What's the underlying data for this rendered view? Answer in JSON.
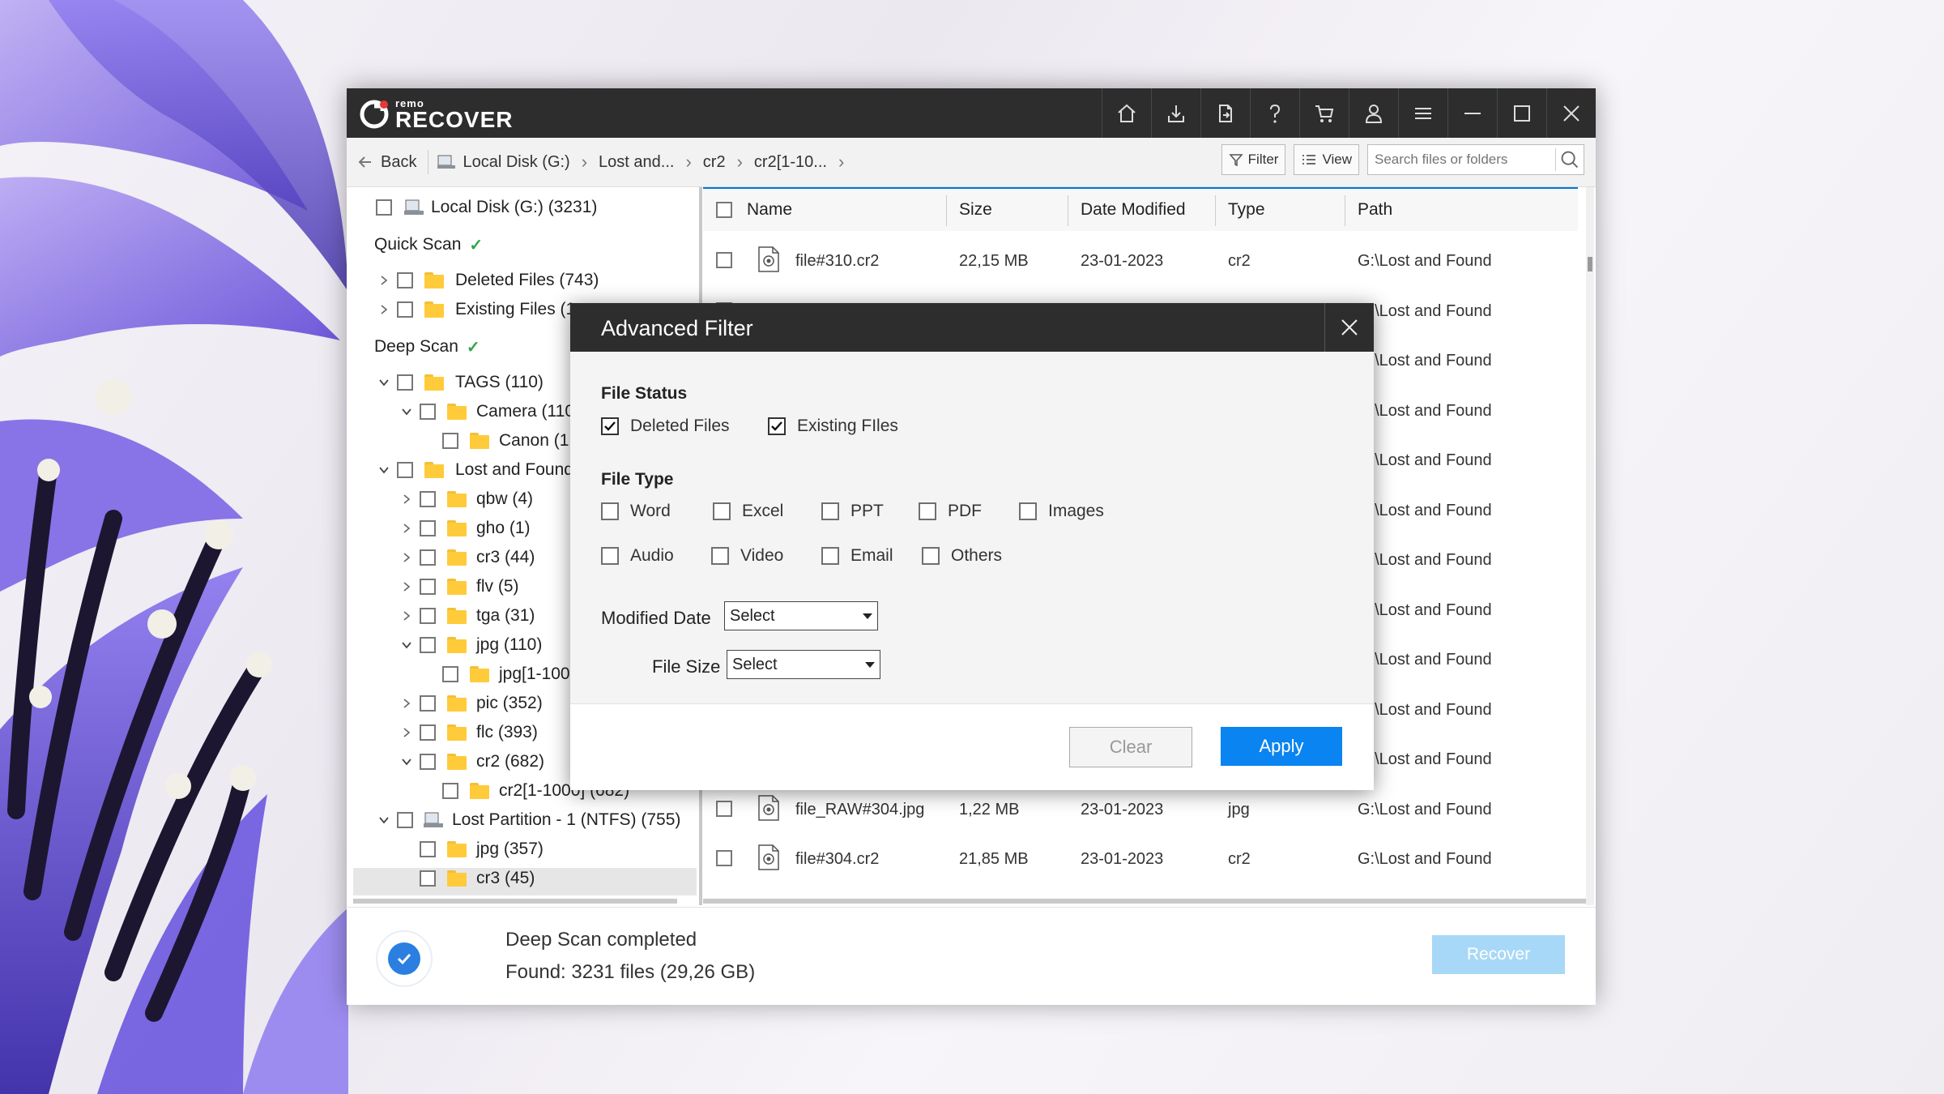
{
  "app": {
    "logo_small": "remo",
    "logo_big": "RECOVER",
    "toolbar_icons": [
      "home-icon",
      "save-icon",
      "export-icon",
      "help-icon",
      "cart-icon",
      "user-icon",
      "menu-icon",
      "minimize-icon",
      "maximize-icon",
      "close-icon"
    ]
  },
  "nav": {
    "back": "Back",
    "crumbs": [
      "Local Disk (G:)",
      "Lost and...",
      "cr2",
      "cr2[1-10..."
    ],
    "filter": "Filter",
    "view": "View",
    "search_placeholder": "Search files or folders"
  },
  "tree": {
    "root": "Local Disk (G:) (3231)",
    "quick_scan": "Quick Scan",
    "deep_scan": "Deep Scan",
    "items": [
      {
        "label": "Deleted Files (743)"
      },
      {
        "label": "Existing Files (1"
      },
      {
        "label": "TAGS (110)"
      },
      {
        "label": "Camera (110"
      },
      {
        "label": "Canon (1"
      },
      {
        "label": "Lost and Found"
      },
      {
        "label": "qbw (4)"
      },
      {
        "label": "gho (1)"
      },
      {
        "label": "cr3 (44)"
      },
      {
        "label": "flv (5)"
      },
      {
        "label": "tga (31)"
      },
      {
        "label": "jpg (110)"
      },
      {
        "label": "jpg[1-100"
      },
      {
        "label": "pic (352)"
      },
      {
        "label": "flc (393)"
      },
      {
        "label": "cr2 (682)"
      },
      {
        "label": "cr2[1-1000] (682)"
      },
      {
        "label": "Lost Partition - 1 (NTFS) (755)"
      },
      {
        "label": "jpg (357)"
      },
      {
        "label": "cr3 (45)"
      }
    ]
  },
  "table": {
    "columns": [
      "Name",
      "Size",
      "Date Modified",
      "Type",
      "Path"
    ],
    "rows": [
      {
        "name": "file#310.cr2",
        "size": "22,15 MB",
        "date": "23-01-2023",
        "type": "cr2",
        "path": "G:\\Lost and Found"
      },
      {
        "name": "",
        "size": "",
        "date": "",
        "type": "",
        "path": "G:\\Lost and Found"
      },
      {
        "name": "",
        "size": "",
        "date": "",
        "type": "",
        "path": "G:\\Lost and Found"
      },
      {
        "name": "",
        "size": "",
        "date": "",
        "type": "",
        "path": "G:\\Lost and Found"
      },
      {
        "name": "",
        "size": "",
        "date": "",
        "type": "",
        "path": "G:\\Lost and Found"
      },
      {
        "name": "",
        "size": "",
        "date": "",
        "type": "",
        "path": "G:\\Lost and Found"
      },
      {
        "name": "",
        "size": "",
        "date": "",
        "type": "",
        "path": "G:\\Lost and Found"
      },
      {
        "name": "",
        "size": "",
        "date": "",
        "type": "",
        "path": "G:\\Lost and Found"
      },
      {
        "name": "",
        "size": "",
        "date": "",
        "type": "",
        "path": "G:\\Lost and Found"
      },
      {
        "name": "",
        "size": "",
        "date": "",
        "type": "",
        "path": "G:\\Lost and Found"
      },
      {
        "name": "",
        "size": "",
        "date": "",
        "type": "",
        "path": "G:\\Lost and Found"
      },
      {
        "name": "file_RAW#304.jpg",
        "size": "1,22 MB",
        "date": "23-01-2023",
        "type": "jpg",
        "path": "G:\\Lost and Found"
      },
      {
        "name": "file#304.cr2",
        "size": "21,85 MB",
        "date": "23-01-2023",
        "type": "cr2",
        "path": "G:\\Lost and Found"
      }
    ]
  },
  "status": {
    "title": "Deep Scan completed",
    "found": "Found: 3231 files (29,26 GB)",
    "recover": "Recover"
  },
  "dialog": {
    "title": "Advanced Filter",
    "file_status": "File Status",
    "deleted_files": "Deleted Files",
    "existing_files": "Existing FIles",
    "file_type": "File Type",
    "types": [
      "Word",
      "Excel",
      "PPT",
      "PDF",
      "Images",
      "Audio",
      "Video",
      "Email",
      "Others"
    ],
    "modified_date_label": "Modified Date",
    "modified_date_value": "Select",
    "file_size_label": "File Size",
    "file_size_value": "Select",
    "clear": "Clear",
    "apply": "Apply"
  },
  "colors": {
    "titlebar": "#2d2d2d",
    "accent": "#0a84f0",
    "scan_check": "#2fa64a",
    "recover_disabled": "#a8d8f7"
  }
}
